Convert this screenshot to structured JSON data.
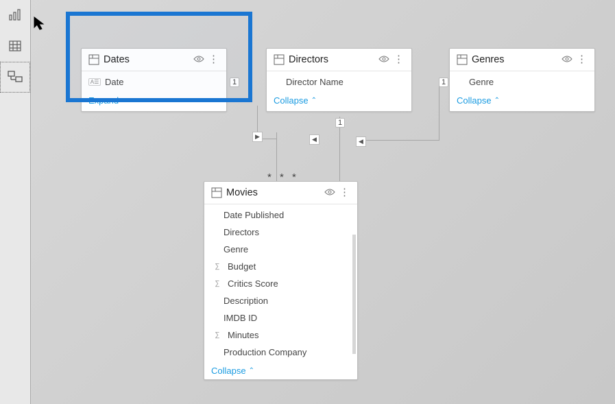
{
  "sidebar": {
    "items": [
      {
        "name": "report-view"
      },
      {
        "name": "data-view"
      },
      {
        "name": "model-view"
      }
    ]
  },
  "tables": {
    "dates": {
      "title": "Dates",
      "fields": [
        {
          "label": "Date",
          "type": "text"
        }
      ],
      "toggle": "Expand"
    },
    "directors": {
      "title": "Directors",
      "fields": [
        {
          "label": "Director Name"
        }
      ],
      "toggle": "Collapse"
    },
    "genres": {
      "title": "Genres",
      "fields": [
        {
          "label": "Genre"
        }
      ],
      "toggle": "Collapse"
    },
    "movies": {
      "title": "Movies",
      "fields": [
        {
          "label": "Date Published"
        },
        {
          "label": "Directors"
        },
        {
          "label": "Genre"
        },
        {
          "label": "Budget",
          "sigma": true
        },
        {
          "label": "Critics Score",
          "sigma": true
        },
        {
          "label": "Description"
        },
        {
          "label": "IMDB ID"
        },
        {
          "label": "Minutes",
          "sigma": true
        },
        {
          "label": "Production Company"
        }
      ],
      "toggle": "Collapse"
    }
  },
  "cardinality": {
    "one": "1",
    "many": "*"
  }
}
